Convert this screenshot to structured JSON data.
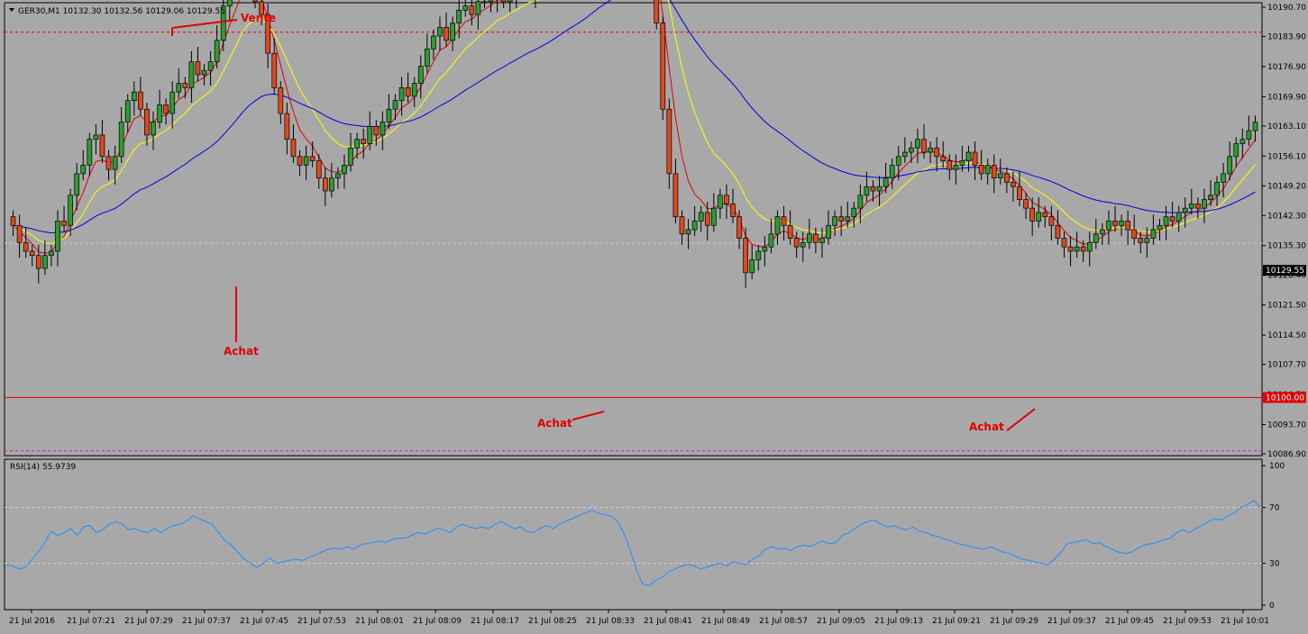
{
  "header": {
    "symbol_info": "GER30,M1  10132.30 10132.56 10129.06 10129.55"
  },
  "colors": {
    "background": "#a8a8a8",
    "bull": "#2e9c2e",
    "bear": "#e0491d",
    "ma_fast": "#e00000",
    "ma_mid": "#ffff00",
    "ma_slow": "#0000e0",
    "rsi": "#1e90ff",
    "support": "#e00000",
    "annotation": "#e00000"
  },
  "chart_data": [
    {
      "type": "candlestick",
      "y_ticks": [
        "10190.70",
        "10183.90",
        "10176.90",
        "10169.90",
        "10163.10",
        "10156.10",
        "10149.20",
        "10142.30",
        "10135.30",
        "10128.40",
        "10121.50",
        "10114.50",
        "10107.70",
        "10100.70",
        "10093.70",
        "10086.90"
      ],
      "ylim": [
        10086.9,
        10190.7
      ],
      "current_price": "10129.55",
      "support_level": "10100.00",
      "close_start": 10140,
      "close_deltas": [
        -4,
        -2,
        -1,
        -3,
        3,
        1,
        7,
        -1,
        7,
        5,
        2,
        6,
        1,
        -5,
        -3,
        3,
        8,
        5,
        2,
        -4,
        -6,
        3,
        4,
        -2,
        5,
        2,
        -1,
        6,
        -3,
        1,
        2,
        5,
        8,
        4,
        3,
        4,
        -4,
        -6,
        -3,
        -9,
        -8,
        -6,
        -6,
        -4,
        -2,
        2,
        -1,
        -4,
        -3,
        3,
        1,
        2,
        4,
        2,
        -1,
        4,
        -2,
        3,
        3,
        2,
        3,
        -2,
        3,
        4,
        4,
        3,
        2,
        -3,
        4,
        3,
        1,
        -2,
        3,
        0,
        1,
        2,
        -3,
        3,
        -1,
        2,
        0,
        -2,
        3,
        2,
        2,
        3,
        1,
        -1,
        1,
        4,
        3,
        1,
        -2,
        1,
        1,
        -1,
        0,
        -2,
        -3,
        -8,
        -12,
        -20,
        -15,
        -10,
        -4,
        1,
        2,
        2,
        -3,
        4,
        3,
        -2,
        -3,
        -5,
        -8,
        3,
        2,
        1,
        3,
        4,
        -2,
        -3,
        -2,
        1,
        2,
        -2,
        1,
        3,
        2,
        -1,
        1,
        2,
        3,
        2,
        -1,
        1,
        2,
        3,
        2,
        1,
        1,
        2,
        -3,
        1,
        -2,
        -1,
        -2,
        1,
        1,
        2,
        -3,
        -2,
        2,
        -3,
        1,
        -2,
        -1,
        -3,
        -2,
        -3,
        2,
        -1,
        -2,
        -3,
        -2,
        -1,
        1,
        -1,
        2,
        2,
        1,
        2,
        -1,
        1,
        -2,
        -2,
        -1,
        1,
        2,
        1,
        2,
        -1,
        2,
        1,
        1,
        -1,
        2,
        1,
        3,
        2,
        4,
        3,
        1,
        2,
        2
      ]
    },
    {
      "type": "line",
      "title": "RSI(14) 55.9739",
      "y_ticks": [
        "100",
        "70",
        "30",
        "0"
      ],
      "ylim": [
        0,
        100
      ],
      "levels": [
        70,
        30
      ],
      "values": [
        29,
        28,
        26,
        27,
        33,
        38,
        45,
        53,
        50,
        52,
        55,
        50,
        56,
        57,
        52,
        54,
        58,
        60,
        58,
        54,
        55,
        53,
        52,
        55,
        52,
        55,
        57,
        58,
        60,
        64,
        62,
        60,
        58,
        52,
        46,
        43,
        38,
        33,
        30,
        27,
        30,
        34,
        30,
        31,
        32,
        33,
        32,
        34,
        36,
        38,
        40,
        41,
        40,
        42,
        40,
        43,
        44,
        45,
        46,
        45,
        47,
        48,
        48,
        50,
        52,
        51,
        53,
        55,
        54,
        52,
        56,
        58,
        56,
        55,
        56,
        55,
        58,
        60,
        57,
        55,
        56,
        53,
        52,
        55,
        57,
        55,
        58,
        60,
        62,
        64,
        66,
        68,
        66,
        65,
        64,
        60,
        52,
        40,
        25,
        15,
        14,
        18,
        20,
        24,
        26,
        28,
        29,
        28,
        26,
        27,
        29,
        30,
        28,
        31,
        30,
        29,
        33,
        35,
        40,
        42,
        40,
        41,
        39,
        42,
        43,
        42,
        44,
        46,
        44,
        45,
        50,
        52,
        55,
        58,
        60,
        61,
        58,
        56,
        57,
        55,
        54,
        56,
        53,
        52,
        50,
        49,
        47,
        46,
        44,
        43,
        42,
        41,
        40,
        42,
        40,
        38,
        37,
        35,
        33,
        32,
        31,
        30,
        29,
        33,
        38,
        44,
        45,
        46,
        47,
        44,
        45,
        42,
        40,
        38,
        37,
        38,
        41,
        43,
        44,
        45,
        47,
        48,
        52,
        54,
        52,
        55,
        57,
        60,
        62,
        61,
        64,
        66,
        70,
        72,
        75,
        70
      ]
    }
  ],
  "time_labels": [
    "21 Jul 2016",
    "21 Jul 07:21",
    "21 Jul 07:29",
    "21 Jul 07:37",
    "21 Jul 07:45",
    "21 Jul 07:53",
    "21 Jul 08:01",
    "21 Jul 08:09",
    "21 Jul 08:17",
    "21 Jul 08:25",
    "21 Jul 08:33",
    "21 Jul 08:41",
    "21 Jul 08:49",
    "21 Jul 08:57",
    "21 Jul 09:05",
    "21 Jul 09:13",
    "21 Jul 09:21",
    "21 Jul 09:29",
    "21 Jul 09:37",
    "21 Jul 09:45",
    "21 Jul 09:53",
    "21 Jul 10:01"
  ],
  "annotations": {
    "sell": "Vente",
    "buy_1": "Achat",
    "buy_2": "Achat",
    "buy_3": "Achat"
  }
}
